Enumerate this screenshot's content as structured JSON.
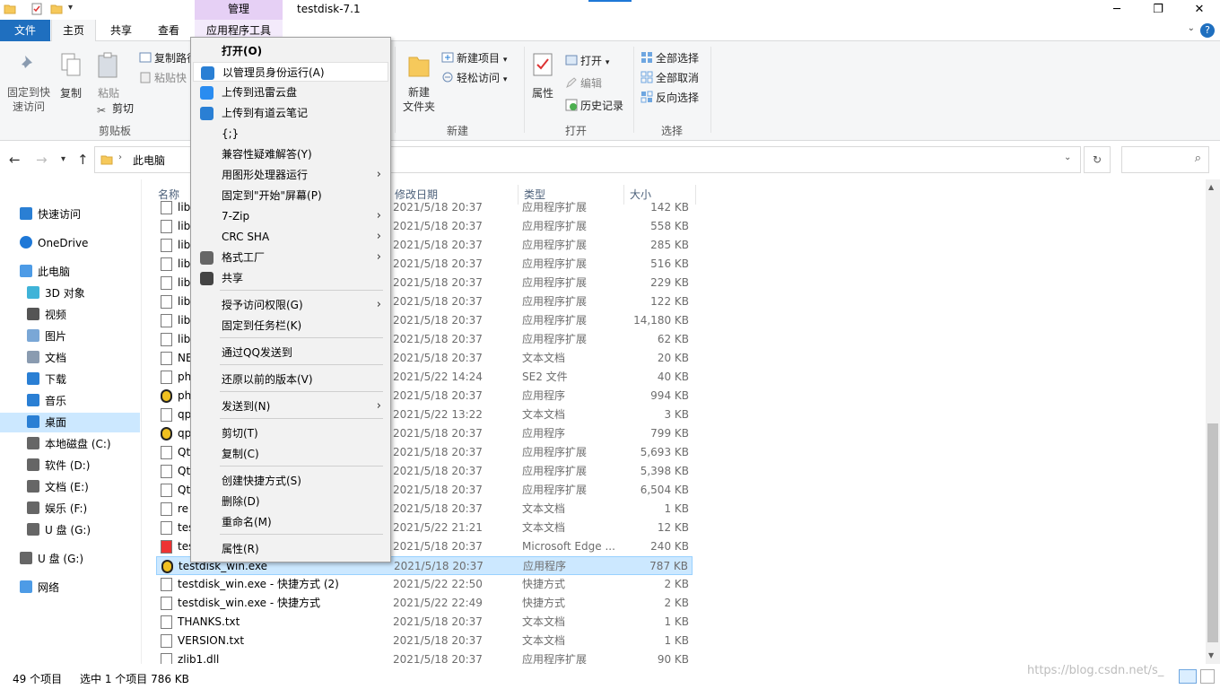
{
  "window": {
    "title": "testdisk-7.1",
    "manage_label": "管理",
    "minimize": "─",
    "maximize": "❐",
    "close": "✕"
  },
  "ribbon_tabs": {
    "file": "文件",
    "home": "主页",
    "share": "共享",
    "view": "查看",
    "app_tools": "应用程序工具",
    "help": "?"
  },
  "ribbon": {
    "pin_quick": "固定到快速访问",
    "copy": "复制",
    "paste": "粘贴",
    "copy_path": "复制路径",
    "paste_shortcut": "粘贴快",
    "cut": "剪切",
    "clipboard_group": "剪贴板",
    "new_item": "新建项目",
    "easy_access": "轻松访问",
    "new_folder": "新建\n文件夹",
    "new_folder_l1": "新建",
    "new_folder_l2": "文件夹",
    "new_group": "新建",
    "properties": "属性",
    "open": "打开",
    "edit": "编辑",
    "history": "历史记录",
    "open_group": "打开",
    "select_all": "全部选择",
    "select_none": "全部取消",
    "invert_select": "反向选择",
    "select_group": "选择"
  },
  "address": {
    "crumb_pc": "此电脑",
    "refresh": "↻"
  },
  "sidebar": {
    "items": [
      {
        "label": "快速访问",
        "icon": "star-icon"
      },
      {
        "label": "OneDrive",
        "icon": "cloud-icon"
      },
      {
        "label": "此电脑",
        "icon": "computer-icon"
      },
      {
        "label": "3D 对象",
        "icon": "cube-icon"
      },
      {
        "label": "视频",
        "icon": "video-icon"
      },
      {
        "label": "图片",
        "icon": "picture-icon"
      },
      {
        "label": "文档",
        "icon": "document-icon"
      },
      {
        "label": "下载",
        "icon": "download-icon"
      },
      {
        "label": "音乐",
        "icon": "music-icon"
      },
      {
        "label": "桌面",
        "icon": "desktop-icon"
      },
      {
        "label": "本地磁盘 (C:)",
        "icon": "drive-icon"
      },
      {
        "label": "软件 (D:)",
        "icon": "drive-icon"
      },
      {
        "label": "文档 (E:)",
        "icon": "drive-icon"
      },
      {
        "label": "娱乐 (F:)",
        "icon": "drive-icon"
      },
      {
        "label": "U 盘 (G:)",
        "icon": "usb-drive-icon"
      },
      {
        "label": "U 盘 (G:)",
        "icon": "usb-drive-icon"
      },
      {
        "label": "网络",
        "icon": "network-icon"
      }
    ]
  },
  "columns": {
    "name": "名称",
    "date": "修改日期",
    "type": "类型",
    "size": "大小"
  },
  "files": [
    {
      "name": "lib",
      "date": "2021/5/18 20:37",
      "type": "应用程序扩展",
      "size": "142 KB"
    },
    {
      "name": "lib",
      "date": "2021/5/18 20:37",
      "type": "应用程序扩展",
      "size": "558 KB"
    },
    {
      "name": "lib",
      "date": "2021/5/18 20:37",
      "type": "应用程序扩展",
      "size": "285 KB"
    },
    {
      "name": "lib",
      "date": "2021/5/18 20:37",
      "type": "应用程序扩展",
      "size": "516 KB"
    },
    {
      "name": "lib",
      "date": "2021/5/18 20:37",
      "type": "应用程序扩展",
      "size": "229 KB"
    },
    {
      "name": "lib",
      "date": "2021/5/18 20:37",
      "type": "应用程序扩展",
      "size": "122 KB"
    },
    {
      "name": "lib",
      "date": "2021/5/18 20:37",
      "type": "应用程序扩展",
      "size": "14,180 KB"
    },
    {
      "name": "lib",
      "date": "2021/5/18 20:37",
      "type": "应用程序扩展",
      "size": "62 KB"
    },
    {
      "name": "NE",
      "date": "2021/5/18 20:37",
      "type": "文本文档",
      "size": "20 KB"
    },
    {
      "name": "ph",
      "date": "2021/5/22 14:24",
      "type": "SE2 文件",
      "size": "40 KB"
    },
    {
      "name": "ph",
      "date": "2021/5/18 20:37",
      "type": "应用程序",
      "size": "994 KB"
    },
    {
      "name": "qp",
      "date": "2021/5/22 13:22",
      "type": "文本文档",
      "size": "3 KB"
    },
    {
      "name": "qp",
      "date": "2021/5/18 20:37",
      "type": "应用程序",
      "size": "799 KB"
    },
    {
      "name": "Qt",
      "date": "2021/5/18 20:37",
      "type": "应用程序扩展",
      "size": "5,693 KB"
    },
    {
      "name": "Qt",
      "date": "2021/5/18 20:37",
      "type": "应用程序扩展",
      "size": "5,398 KB"
    },
    {
      "name": "Qt",
      "date": "2021/5/18 20:37",
      "type": "应用程序扩展",
      "size": "6,504 KB"
    },
    {
      "name": "re",
      "date": "2021/5/18 20:37",
      "type": "文本文档",
      "size": "1 KB"
    },
    {
      "name": "tes",
      "date": "2021/5/22 21:21",
      "type": "文本文档",
      "size": "12 KB"
    },
    {
      "name": "tes",
      "date": "2021/5/18 20:37",
      "type": "Microsoft Edge ...",
      "size": "240 KB"
    },
    {
      "name": "testdisk_win.exe",
      "date": "2021/5/18 20:37",
      "type": "应用程序",
      "size": "787 KB"
    },
    {
      "name": "testdisk_win.exe - 快捷方式 (2)",
      "date": "2021/5/22 22:50",
      "type": "快捷方式",
      "size": "2 KB"
    },
    {
      "name": "testdisk_win.exe - 快捷方式",
      "date": "2021/5/22 22:49",
      "type": "快捷方式",
      "size": "2 KB"
    },
    {
      "name": "THANKS.txt",
      "date": "2021/5/18 20:37",
      "type": "文本文档",
      "size": "1 KB"
    },
    {
      "name": "VERSION.txt",
      "date": "2021/5/18 20:37",
      "type": "文本文档",
      "size": "1 KB"
    },
    {
      "name": "zlib1.dll",
      "date": "2021/5/18 20:37",
      "type": "应用程序扩展",
      "size": "90 KB"
    }
  ],
  "status": {
    "count": "49 个项目",
    "selected": "选中 1 个项目  786 KB"
  },
  "watermark": "https://blog.csdn.net/s_",
  "context_menu": {
    "items": [
      {
        "label": "打开(O)",
        "bold": true
      },
      {
        "label": "以管理员身份运行(A)",
        "icon": "uac-shield-icon"
      },
      {
        "label": "上传到迅雷云盘",
        "icon": "xunlei-icon"
      },
      {
        "label": "上传到有道云笔记",
        "icon": "youdao-icon"
      },
      {
        "label": "{;}"
      },
      {
        "label": "兼容性疑难解答(Y)"
      },
      {
        "label": "用图形处理器运行",
        "submenu": true
      },
      {
        "label": "固定到\"开始\"屏幕(P)"
      },
      {
        "label": "7-Zip",
        "submenu": true
      },
      {
        "label": "CRC SHA",
        "submenu": true
      },
      {
        "label": "格式工厂",
        "icon": "format-factory-icon",
        "submenu": true
      },
      {
        "label": "共享",
        "icon": "share-icon"
      },
      {
        "label": "授予访问权限(G)",
        "submenu": true
      },
      {
        "label": "固定到任务栏(K)"
      },
      {
        "label": "通过QQ发送到"
      },
      {
        "label": "还原以前的版本(V)"
      },
      {
        "label": "发送到(N)",
        "submenu": true
      },
      {
        "label": "剪切(T)"
      },
      {
        "label": "复制(C)"
      },
      {
        "label": "创建快捷方式(S)"
      },
      {
        "label": "删除(D)"
      },
      {
        "label": "重命名(M)"
      },
      {
        "label": "属性(R)"
      }
    ],
    "arrow": "›"
  },
  "colors": {
    "accent": "#1f6fbf",
    "selection": "#cce8ff",
    "manage_tab": "#e6d0f5"
  }
}
